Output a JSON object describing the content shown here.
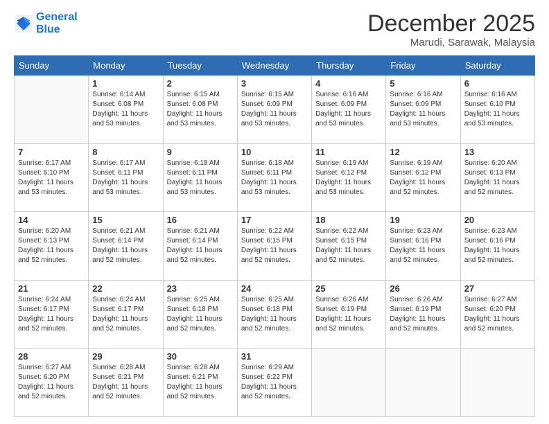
{
  "header": {
    "logo_line1": "General",
    "logo_line2": "Blue",
    "month_title": "December 2025",
    "location": "Marudi, Sarawak, Malaysia"
  },
  "days_of_week": [
    "Sunday",
    "Monday",
    "Tuesday",
    "Wednesday",
    "Thursday",
    "Friday",
    "Saturday"
  ],
  "weeks": [
    [
      {
        "day": "",
        "info": ""
      },
      {
        "day": "1",
        "info": "Sunrise: 6:14 AM\nSunset: 6:08 PM\nDaylight: 11 hours\nand 53 minutes."
      },
      {
        "day": "2",
        "info": "Sunrise: 6:15 AM\nSunset: 6:08 PM\nDaylight: 11 hours\nand 53 minutes."
      },
      {
        "day": "3",
        "info": "Sunrise: 6:15 AM\nSunset: 6:09 PM\nDaylight: 11 hours\nand 53 minutes."
      },
      {
        "day": "4",
        "info": "Sunrise: 6:16 AM\nSunset: 6:09 PM\nDaylight: 11 hours\nand 53 minutes."
      },
      {
        "day": "5",
        "info": "Sunrise: 6:16 AM\nSunset: 6:09 PM\nDaylight: 11 hours\nand 53 minutes."
      },
      {
        "day": "6",
        "info": "Sunrise: 6:16 AM\nSunset: 6:10 PM\nDaylight: 11 hours\nand 53 minutes."
      }
    ],
    [
      {
        "day": "7",
        "info": "Sunrise: 6:17 AM\nSunset: 6:10 PM\nDaylight: 11 hours\nand 53 minutes."
      },
      {
        "day": "8",
        "info": "Sunrise: 6:17 AM\nSunset: 6:11 PM\nDaylight: 11 hours\nand 53 minutes."
      },
      {
        "day": "9",
        "info": "Sunrise: 6:18 AM\nSunset: 6:11 PM\nDaylight: 11 hours\nand 53 minutes."
      },
      {
        "day": "10",
        "info": "Sunrise: 6:18 AM\nSunset: 6:11 PM\nDaylight: 11 hours\nand 53 minutes."
      },
      {
        "day": "11",
        "info": "Sunrise: 6:19 AM\nSunset: 6:12 PM\nDaylight: 11 hours\nand 53 minutes."
      },
      {
        "day": "12",
        "info": "Sunrise: 6:19 AM\nSunset: 6:12 PM\nDaylight: 11 hours\nand 52 minutes."
      },
      {
        "day": "13",
        "info": "Sunrise: 6:20 AM\nSunset: 6:13 PM\nDaylight: 11 hours\nand 52 minutes."
      }
    ],
    [
      {
        "day": "14",
        "info": "Sunrise: 6:20 AM\nSunset: 6:13 PM\nDaylight: 11 hours\nand 52 minutes."
      },
      {
        "day": "15",
        "info": "Sunrise: 6:21 AM\nSunset: 6:14 PM\nDaylight: 11 hours\nand 52 minutes."
      },
      {
        "day": "16",
        "info": "Sunrise: 6:21 AM\nSunset: 6:14 PM\nDaylight: 11 hours\nand 52 minutes."
      },
      {
        "day": "17",
        "info": "Sunrise: 6:22 AM\nSunset: 6:15 PM\nDaylight: 11 hours\nand 52 minutes."
      },
      {
        "day": "18",
        "info": "Sunrise: 6:22 AM\nSunset: 6:15 PM\nDaylight: 11 hours\nand 52 minutes."
      },
      {
        "day": "19",
        "info": "Sunrise: 6:23 AM\nSunset: 6:16 PM\nDaylight: 11 hours\nand 52 minutes."
      },
      {
        "day": "20",
        "info": "Sunrise: 6:23 AM\nSunset: 6:16 PM\nDaylight: 11 hours\nand 52 minutes."
      }
    ],
    [
      {
        "day": "21",
        "info": "Sunrise: 6:24 AM\nSunset: 6:17 PM\nDaylight: 11 hours\nand 52 minutes."
      },
      {
        "day": "22",
        "info": "Sunrise: 6:24 AM\nSunset: 6:17 PM\nDaylight: 11 hours\nand 52 minutes."
      },
      {
        "day": "23",
        "info": "Sunrise: 6:25 AM\nSunset: 6:18 PM\nDaylight: 11 hours\nand 52 minutes."
      },
      {
        "day": "24",
        "info": "Sunrise: 6:25 AM\nSunset: 6:18 PM\nDaylight: 11 hours\nand 52 minutes."
      },
      {
        "day": "25",
        "info": "Sunrise: 6:26 AM\nSunset: 6:19 PM\nDaylight: 11 hours\nand 52 minutes."
      },
      {
        "day": "26",
        "info": "Sunrise: 6:26 AM\nSunset: 6:19 PM\nDaylight: 11 hours\nand 52 minutes."
      },
      {
        "day": "27",
        "info": "Sunrise: 6:27 AM\nSunset: 6:20 PM\nDaylight: 11 hours\nand 52 minutes."
      }
    ],
    [
      {
        "day": "28",
        "info": "Sunrise: 6:27 AM\nSunset: 6:20 PM\nDaylight: 11 hours\nand 52 minutes."
      },
      {
        "day": "29",
        "info": "Sunrise: 6:28 AM\nSunset: 6:21 PM\nDaylight: 11 hours\nand 52 minutes."
      },
      {
        "day": "30",
        "info": "Sunrise: 6:28 AM\nSunset: 6:21 PM\nDaylight: 11 hours\nand 52 minutes."
      },
      {
        "day": "31",
        "info": "Sunrise: 6:29 AM\nSunset: 6:22 PM\nDaylight: 11 hours\nand 52 minutes."
      },
      {
        "day": "",
        "info": ""
      },
      {
        "day": "",
        "info": ""
      },
      {
        "day": "",
        "info": ""
      }
    ]
  ]
}
